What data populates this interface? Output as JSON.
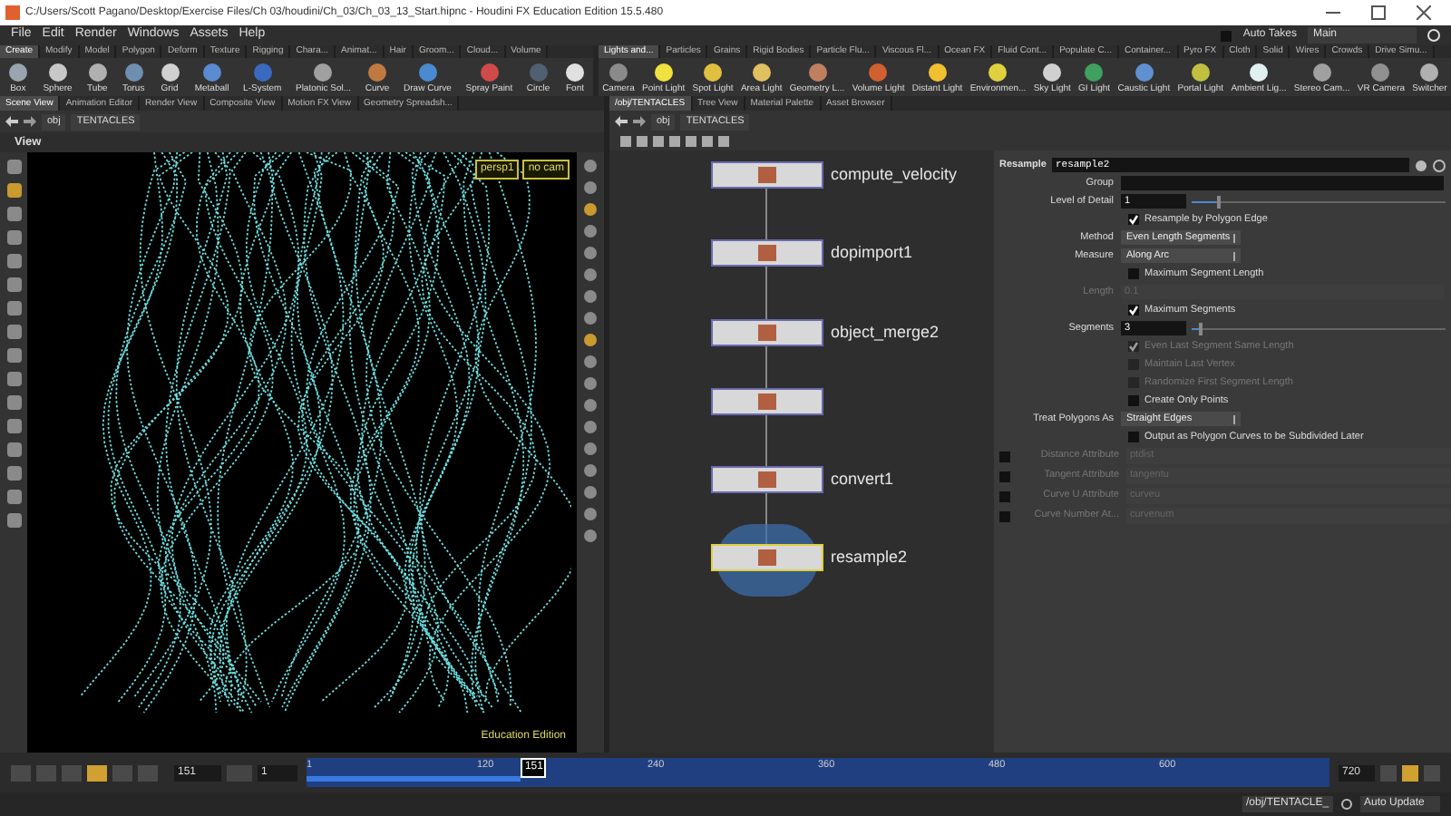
{
  "title_bar": {
    "title": "C:/Users/Scott Pagano/Desktop/Exercise Files/Ch 03/houdini/Ch_03/Ch_03_13_Start.hipnc - Houdini FX Education Edition 15.5.480"
  },
  "menu_bar": {
    "items": [
      "File",
      "Edit",
      "Render",
      "Windows",
      "Assets",
      "Help"
    ],
    "auto_takes": {
      "label": "Auto Takes",
      "checked": false
    },
    "take": "Main"
  },
  "shelf_left": {
    "tabs": [
      {
        "label": "Create",
        "selected": true
      },
      {
        "label": "Modify",
        "selected": false
      },
      {
        "label": "Model",
        "selected": false
      },
      {
        "label": "Polygon",
        "selected": false
      },
      {
        "label": "Deform",
        "selected": false
      },
      {
        "label": "Texture",
        "selected": false
      },
      {
        "label": "Rigging",
        "selected": false
      },
      {
        "label": "Chara...",
        "selected": false
      },
      {
        "label": "Animat...",
        "selected": false
      },
      {
        "label": "Hair",
        "selected": false
      },
      {
        "label": "Groom...",
        "selected": false
      },
      {
        "label": "Cloud...",
        "selected": false
      },
      {
        "label": "Volume",
        "selected": false
      }
    ],
    "tools": [
      {
        "label": "Box",
        "color": "#9aa4ae"
      },
      {
        "label": "Sphere",
        "color": "#c8c8c8"
      },
      {
        "label": "Tube",
        "color": "#b0b0b0"
      },
      {
        "label": "Torus",
        "color": "#6f8fb0"
      },
      {
        "label": "Grid",
        "color": "#d0d0d0"
      },
      {
        "label": "Metaball",
        "color": "#5a8ad0"
      },
      {
        "label": "L-System",
        "color": "#3a6ac0"
      },
      {
        "label": "Platonic Sol...",
        "color": "#a0a0a0"
      },
      {
        "label": "Curve",
        "color": "#c07a40"
      },
      {
        "label": "Draw Curve",
        "color": "#4a8ad0"
      },
      {
        "label": "Spray Paint",
        "color": "#d04a4a"
      },
      {
        "label": "Circle",
        "color": "#506070"
      },
      {
        "label": "Font",
        "color": "#e0e0e0"
      }
    ]
  },
  "shelf_right": {
    "tabs": [
      {
        "label": "Lights and...",
        "selected": true
      },
      {
        "label": "Particles",
        "selected": false
      },
      {
        "label": "Grains",
        "selected": false
      },
      {
        "label": "Rigid Bodies",
        "selected": false
      },
      {
        "label": "Particle Flu...",
        "selected": false
      },
      {
        "label": "Viscous Fl...",
        "selected": false
      },
      {
        "label": "Ocean FX",
        "selected": false
      },
      {
        "label": "Fluid Cont...",
        "selected": false
      },
      {
        "label": "Populate C...",
        "selected": false
      },
      {
        "label": "Container...",
        "selected": false
      },
      {
        "label": "Pyro FX",
        "selected": false
      },
      {
        "label": "Cloth",
        "selected": false
      },
      {
        "label": "Solid",
        "selected": false
      },
      {
        "label": "Wires",
        "selected": false
      },
      {
        "label": "Crowds",
        "selected": false
      },
      {
        "label": "Drive Simu...",
        "selected": false
      }
    ],
    "tools": [
      {
        "label": "Camera",
        "color": "#8a8a8a"
      },
      {
        "label": "Point Light",
        "color": "#f0e040"
      },
      {
        "label": "Spot Light",
        "color": "#e0c040"
      },
      {
        "label": "Area Light",
        "color": "#e0c060"
      },
      {
        "label": "Geometry L...",
        "color": "#c08060"
      },
      {
        "label": "Volume Light",
        "color": "#d06030"
      },
      {
        "label": "Distant Light",
        "color": "#f0c030"
      },
      {
        "label": "Environmen...",
        "color": "#e0d040"
      },
      {
        "label": "Sky Light",
        "color": "#d0d0d0"
      },
      {
        "label": "GI Light",
        "color": "#40a060"
      },
      {
        "label": "Caustic Light",
        "color": "#6090d0"
      },
      {
        "label": "Portal Light",
        "color": "#c0c040"
      },
      {
        "label": "Ambient Lig...",
        "color": "#e0f0f0"
      },
      {
        "label": "Stereo Cam...",
        "color": "#a0a0a0"
      },
      {
        "label": "VR Camera",
        "color": "#909090"
      },
      {
        "label": "Switcher",
        "color": "#b0b0b0"
      }
    ]
  },
  "pane_left": {
    "tabs": [
      {
        "label": "Scene View",
        "selected": true
      },
      {
        "label": "Animation Editor",
        "selected": false
      },
      {
        "label": "Render View",
        "selected": false
      },
      {
        "label": "Composite View",
        "selected": false
      },
      {
        "label": "Motion FX View",
        "selected": false
      },
      {
        "label": "Geometry Spreadsh...",
        "selected": false
      }
    ],
    "path": [
      "obj",
      "TENTACLES"
    ]
  },
  "pane_right": {
    "tabs": [
      {
        "label": "/obj/TENTACLES",
        "selected": true
      },
      {
        "label": "Tree View",
        "selected": false
      },
      {
        "label": "Material Palette",
        "selected": false
      },
      {
        "label": "Asset Browser",
        "selected": false
      }
    ],
    "path": [
      "obj",
      "TENTACLES"
    ]
  },
  "viewport": {
    "title": "View",
    "camera": "persp1",
    "cam_menu": "no cam",
    "badge": "Education Edition"
  },
  "network": {
    "nodes": [
      {
        "name": "compute_velocity",
        "selected": false
      },
      {
        "name": "dopimport1",
        "selected": false
      },
      {
        "name": "object_merge2",
        "selected": false
      },
      {
        "selected": false
      },
      {
        "name": "convert1",
        "selected": false
      },
      {
        "name": "resample2",
        "selected": true
      }
    ]
  },
  "parameters": {
    "node_type": "Resample",
    "node_name": "resample2",
    "rows": [
      {
        "kind": "field",
        "label": "Group",
        "disabled": false
      },
      {
        "kind": "slider",
        "label": "Level of Detail",
        "value": "1",
        "level": 0.1,
        "disabled": false
      },
      {
        "kind": "check",
        "label": "Resample by Polygon Edge",
        "checked": true,
        "disabled": false
      },
      {
        "kind": "menu",
        "label": "Method",
        "value": "Even Length Segments"
      },
      {
        "kind": "menu",
        "label": "Measure",
        "value": "Along Arc"
      },
      {
        "kind": "check",
        "label": "Maximum Segment Length",
        "checked": false,
        "disabled": false
      },
      {
        "kind": "field",
        "label": "Length",
        "value": "0.1",
        "disabled": true
      },
      {
        "kind": "check",
        "label": "Maximum Segments",
        "checked": true,
        "disabled": false
      },
      {
        "kind": "slider",
        "label": "Segments",
        "value": "3",
        "level": 0.03,
        "disabled": false
      },
      {
        "kind": "check",
        "label": "Even Last Segment Same Length",
        "checked": true,
        "disabled": true
      },
      {
        "kind": "check",
        "label": "Maintain Last Vertex",
        "checked": false,
        "disabled": true
      },
      {
        "kind": "check",
        "label": "Randomize First Segment Length",
        "checked": false,
        "disabled": true
      },
      {
        "kind": "check",
        "label": "Create Only Points",
        "checked": false,
        "disabled": false
      },
      {
        "kind": "menu",
        "label": "Treat Polygons As",
        "value": "Straight Edges"
      },
      {
        "kind": "check",
        "label": "Output as Polygon Curves to be Subdivided Later",
        "checked": false,
        "disabled": false
      },
      {
        "kind": "attr",
        "label": "Distance Attribute",
        "value": "ptdist",
        "checked": false,
        "disabled": true
      },
      {
        "kind": "attr",
        "label": "Tangent Attribute",
        "value": "tangentu",
        "checked": false,
        "disabled": true
      },
      {
        "kind": "attr",
        "label": "Curve U Attribute",
        "value": "curveu",
        "checked": false,
        "disabled": true
      },
      {
        "kind": "attr",
        "label": "Curve Number At...",
        "value": "curvenum",
        "checked": false,
        "disabled": true
      }
    ]
  },
  "timeline": {
    "frame": "151",
    "step": "1",
    "ticks": [
      "1",
      "120",
      "240",
      "360",
      "480",
      "600"
    ],
    "current": "151",
    "level": 0.21,
    "end": "720"
  },
  "status_bar": {
    "path": "/obj/TENTACLE_",
    "update_mode": "Auto Update"
  }
}
